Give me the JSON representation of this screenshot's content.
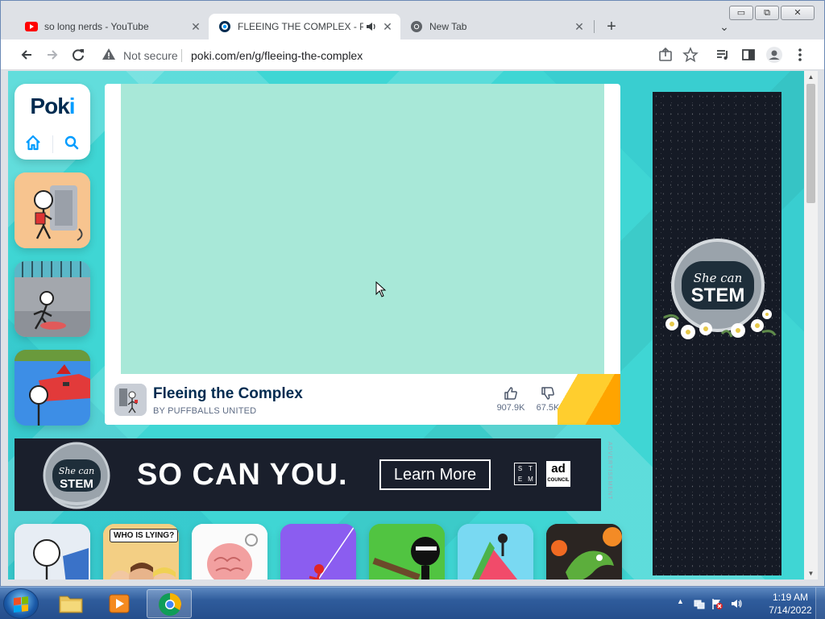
{
  "browser": {
    "tabs": [
      {
        "title": "so long nerds - YouTube",
        "favicon": "youtube-icon"
      },
      {
        "title": "FLEEING THE COMPLEX - Pl",
        "favicon": "poki-icon",
        "audio": true
      },
      {
        "title": "New Tab",
        "favicon": "chrome-icon"
      }
    ],
    "close_glyph": "✕",
    "new_tab_glyph": "+",
    "tab_search_glyph": "⌄",
    "window_controls": {
      "minimize": "▭",
      "maximize": "⧉",
      "close": "✕"
    },
    "security_label": "Not secure",
    "url": "poki.com/en/g/fleeing-the-complex"
  },
  "site": {
    "logo": {
      "prefix": "P",
      "middle": "ok",
      "suffix": "i"
    },
    "game": {
      "title": "Fleeing the Complex",
      "author": "BY PUFFBALLS UNITED",
      "likes": "907.9K",
      "dislikes": "67.5K"
    },
    "banner_ad": {
      "headline": "SO CAN YOU.",
      "cta": "Learn More",
      "stem_letters": [
        "S",
        "T",
        "E",
        "M"
      ],
      "adcouncil_main": "ad",
      "adcouncil_sub": "COUNCIL",
      "side_label": "ADVERTISEMENT",
      "helmet_line1": "She can",
      "helmet_line2": "STEM"
    },
    "side_ad": {
      "helmet_line1": "She can",
      "helmet_line2": "STEM"
    },
    "bottom_tiles": [
      {
        "label": ""
      },
      {
        "label": "WHO IS LYING?"
      },
      {
        "label": ""
      },
      {
        "label": ""
      },
      {
        "label": ""
      },
      {
        "label": ""
      },
      {
        "label": ""
      }
    ]
  },
  "taskbar": {
    "time": "1:19 AM",
    "date": "7/14/2022"
  },
  "colors": {
    "poki_navy": "#002b50",
    "poki_blue": "#009cff",
    "page_teal": "#3fd6d4",
    "game_canvas": "#a8e8d8"
  }
}
